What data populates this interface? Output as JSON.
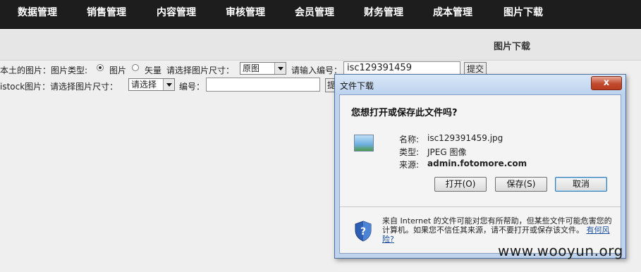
{
  "nav": {
    "items": [
      "数据管理",
      "销售管理",
      "内容管理",
      "审核管理",
      "会员管理",
      "财务管理",
      "成本管理",
      "图片下载"
    ]
  },
  "subheader": {
    "title": "图片下载"
  },
  "row1": {
    "label": "本土的图片：图片类型:",
    "radio_image": "图片",
    "radio_vector": "矢量",
    "size_label": "请选择图片尺寸：",
    "size_value": "原图",
    "code_label": "请输入编号：",
    "code_value": "isc129391459",
    "submit": "提交"
  },
  "row2": {
    "label": "istock图片：请选择图片尺寸：",
    "size_value": "请选择",
    "code_label": "编号：",
    "code_value": "",
    "submit": "提"
  },
  "dialog": {
    "title": "文件下载",
    "close": "x",
    "question": "您想打开或保存此文件吗?",
    "name_label": "名称:",
    "name_value": "isc129391459.jpg",
    "type_label": "类型:",
    "type_value": "JPEG 图像",
    "source_label": "来源:",
    "source_value": "admin.fotomore.com",
    "open_button": "打开(O)",
    "save_button": "保存(S)",
    "cancel_button": "取消",
    "warning_text": "来自 Internet 的文件可能对您有所帮助，但某些文件可能危害您的计算机。如果您不信任其来源，请不要打开或保存该文件。",
    "warning_link": "有何风险?"
  },
  "watermark": "www.wooyun.org"
}
